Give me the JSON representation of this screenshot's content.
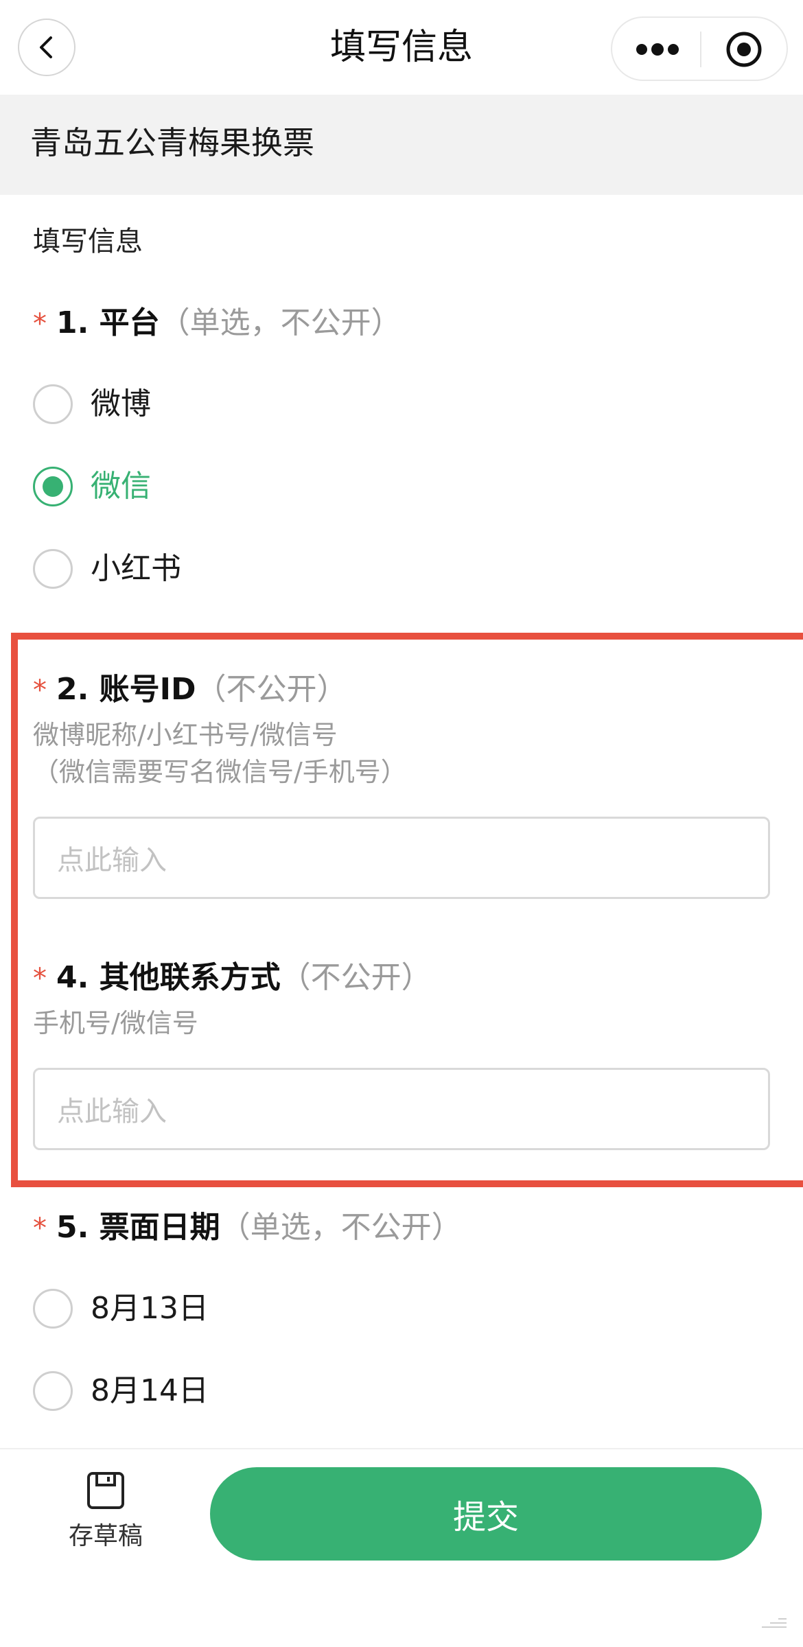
{
  "nav": {
    "title": "填写信息",
    "back_icon": "chevron-left-icon",
    "more_icon": "more-dots-icon",
    "close_icon": "target-circle-icon"
  },
  "form": {
    "title": "青岛五公青梅果换票",
    "section_heading": "填写信息"
  },
  "questions": {
    "q1": {
      "required_mark": "*",
      "title": "1. 平台",
      "note": "（单选，不公开）",
      "options": [
        {
          "label": "微博",
          "selected": false
        },
        {
          "label": "微信",
          "selected": true
        },
        {
          "label": "小红书",
          "selected": false
        }
      ]
    },
    "q2": {
      "required_mark": "*",
      "title": "2. 账号ID",
      "note": "（不公开）",
      "hint_line1": "微博昵称/小红书号/微信号",
      "hint_line2": "（微信需要写名微信号/手机号）",
      "placeholder": "点此输入"
    },
    "q4": {
      "required_mark": "*",
      "title": "4. 其他联系方式",
      "note": "（不公开）",
      "hint": "手机号/微信号",
      "placeholder": "点此输入"
    },
    "q5": {
      "required_mark": "*",
      "title": "5. 票面日期",
      "note": "（单选，不公开）",
      "options": [
        {
          "label": "8月13日",
          "selected": false
        },
        {
          "label": "8月14日",
          "selected": false
        }
      ]
    }
  },
  "bottom": {
    "draft_label": "存草稿",
    "submit_label": "提交"
  },
  "colors": {
    "accent": "#37b173",
    "required": "#e5503d",
    "highlight_border": "#e8503f"
  }
}
